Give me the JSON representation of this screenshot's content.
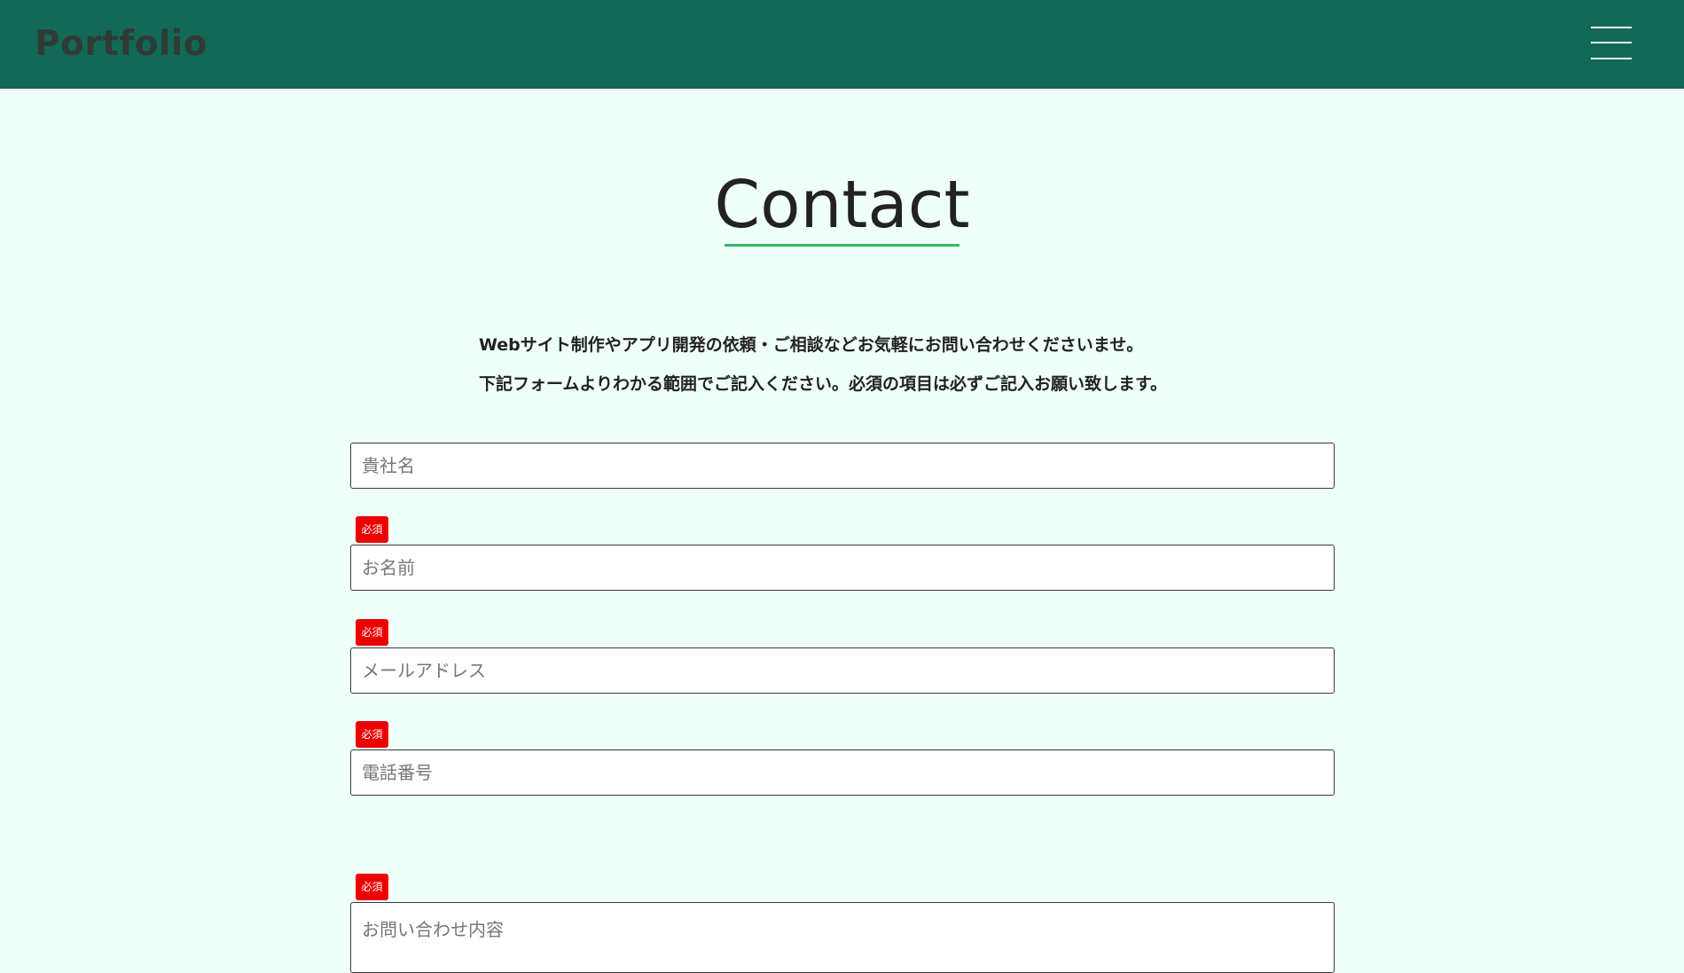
{
  "header": {
    "logo": "Portfolio",
    "menu_icon": "hamburger-menu-icon",
    "background": "#136957"
  },
  "main": {
    "title": "Contact",
    "intro": [
      "Webサイト制作やアプリ開発の依頼・ご相談などお気軽にお問い合わせくださいませ。",
      "下記フォームよりわかる範囲でご記入ください。必須の項目は必ずご記入お願い致します。"
    ]
  },
  "form": {
    "required_label": "必須",
    "company": {
      "placeholder": "貴社名",
      "value": ""
    },
    "name": {
      "placeholder": "お名前",
      "value": ""
    },
    "email": {
      "placeholder": "メールアドレス",
      "value": ""
    },
    "phone": {
      "placeholder": "電話番号",
      "value": ""
    },
    "message": {
      "placeholder": "お問い合わせ内容",
      "value": ""
    }
  },
  "colors": {
    "accent": "#35b86a",
    "required_badge": "#ee0000",
    "page_background": "#effff9"
  }
}
